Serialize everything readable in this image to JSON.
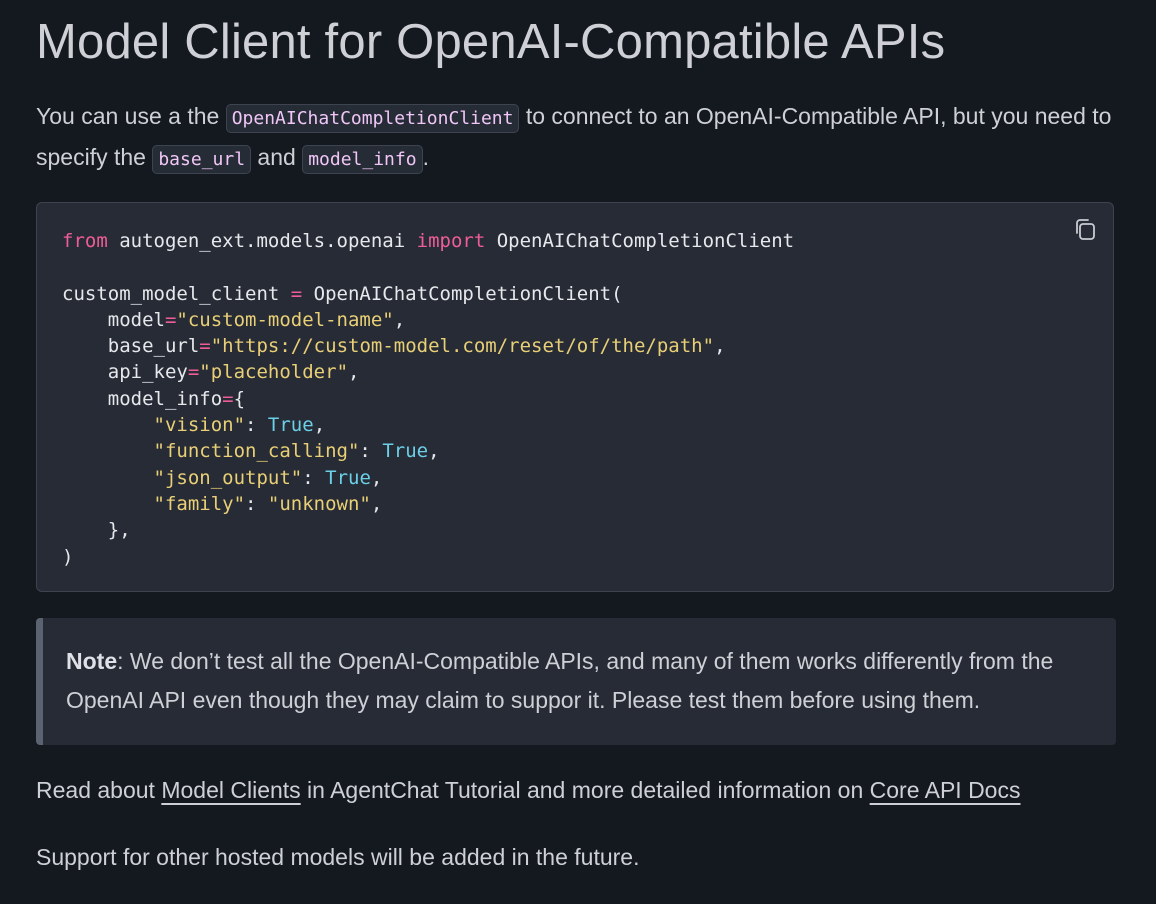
{
  "page": {
    "title": "Model Client for OpenAI-Compatible APIs"
  },
  "intro": {
    "part1": "You can use a the ",
    "code1": "OpenAIChatCompletionClient",
    "part2": " to connect to an OpenAI-Compatible API, but you need to specify the ",
    "code2": "base_url",
    "part3": " and ",
    "code3": "model_info",
    "part4": "."
  },
  "code_block": {
    "copy_icon": "copy-icon",
    "tokens": {
      "from": "from",
      "module": " autogen_ext.models.openai ",
      "import": "import",
      "imported": " OpenAIChatCompletionClient",
      "assign_name": "custom_model_client ",
      "assign_op": "=",
      "ctor": " OpenAIChatCompletionClient(",
      "model_key": "    model",
      "model_val": "\"custom-model-name\"",
      "base_url_key": "    base_url",
      "base_url_val": "\"https://custom-model.com/reset/of/the/path\"",
      "api_key_key": "    api_key",
      "api_key_val": "\"placeholder\"",
      "model_info_key": "    model_info",
      "brace_open": "{",
      "vision_key": "\"vision\"",
      "function_calling_key": "\"function_calling\"",
      "json_output_key": "\"json_output\"",
      "family_key": "\"family\"",
      "family_val": "\"unknown\"",
      "true_val": "True",
      "equals": "=",
      "comma": ",",
      "colon": ": ",
      "indent2": "        ",
      "brace_close": "    },",
      "paren_close": ")"
    }
  },
  "note": {
    "label": "Note",
    "text": ": We don’t test all the OpenAI-Compatible APIs, and many of them works differently from the OpenAI API even though they may claim to suppor it. Please test them before using them."
  },
  "links_line": {
    "prefix": "Read about ",
    "link1": "Model Clients",
    "middle": " in AgentChat Tutorial and more detailed information on ",
    "link2": "Core API Docs"
  },
  "footer": {
    "text": "Support for other hosted models will be added in the future."
  }
}
